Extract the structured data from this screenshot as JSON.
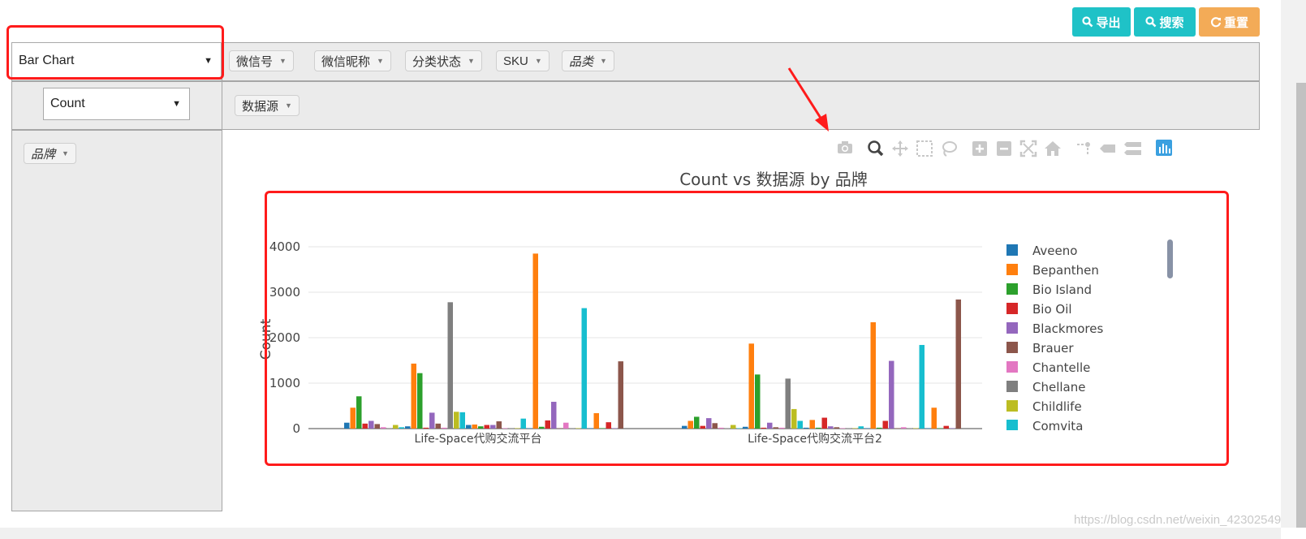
{
  "toolbar": {
    "export_label": "导出",
    "search_label": "搜索",
    "reset_label": "重置"
  },
  "pivot": {
    "renderer_selected": "Bar Chart",
    "aggregator_selected": "Count",
    "column_fields": [
      "微信号",
      "微信昵称",
      "分类状态",
      "SKU",
      "品类"
    ],
    "row_fields": [
      "数据源"
    ],
    "unused_fields": [
      "品牌"
    ]
  },
  "plot_toolbar": {
    "icons": [
      "camera-icon",
      "zoom-icon",
      "pan-icon",
      "box-select-icon",
      "lasso-icon",
      "zoom-in-icon",
      "zoom-out-icon",
      "autoscale-icon",
      "reset-axes-icon",
      "spike-lines-icon",
      "hover-closest-icon",
      "hover-compare-icon",
      "plotly-logo-icon"
    ]
  },
  "chart_data": {
    "type": "bar",
    "title": "Count vs 数据源 by 品牌",
    "xlabel": "",
    "ylabel": "Count",
    "ylim": [
      0,
      4500
    ],
    "yticks": [
      0,
      1000,
      2000,
      3000,
      4000
    ],
    "categories": [
      "Life-Space代购交流平台",
      "Life-Space代购交流平台2"
    ],
    "legend_position": "right",
    "legend_visible": [
      "Aveeno",
      "Bepanthen",
      "Bio Island",
      "Bio Oil",
      "Blackmores",
      "Brauer",
      "Chantelle",
      "Chellane",
      "Childlife",
      "Comvita"
    ],
    "series_values": [
      [
        130,
        60
      ],
      [
        460,
        170
      ],
      [
        710,
        260
      ],
      [
        110,
        60
      ],
      [
        170,
        230
      ],
      [
        100,
        120
      ],
      [
        30,
        20
      ],
      [
        10,
        10
      ],
      [
        80,
        80
      ],
      [
        30,
        10
      ],
      [
        50,
        40
      ],
      [
        1430,
        1870
      ],
      [
        1220,
        1190
      ],
      [
        20,
        20
      ],
      [
        350,
        130
      ],
      [
        110,
        30
      ],
      [
        20,
        20
      ],
      [
        2780,
        1100
      ],
      [
        370,
        430
      ],
      [
        360,
        170
      ],
      [
        80,
        20
      ],
      [
        90,
        190
      ],
      [
        50,
        20
      ],
      [
        80,
        240
      ],
      [
        80,
        50
      ],
      [
        160,
        30
      ],
      [
        10,
        10
      ],
      [
        10,
        10
      ],
      [
        10,
        10
      ],
      [
        220,
        50
      ],
      [
        10,
        10
      ],
      [
        3850,
        2340
      ],
      [
        40,
        20
      ],
      [
        180,
        170
      ],
      [
        590,
        1490
      ],
      [
        10,
        10
      ],
      [
        130,
        30
      ],
      [
        10,
        10
      ],
      [
        10,
        10
      ],
      [
        2650,
        1840
      ],
      [
        10,
        10
      ],
      [
        340,
        460
      ],
      [
        10,
        10
      ],
      [
        140,
        60
      ],
      [
        10,
        10
      ],
      [
        1480,
        2840
      ]
    ],
    "colors": [
      "#1f77b4",
      "#ff7f0e",
      "#2ca02c",
      "#d62728",
      "#9467bd",
      "#8c564b",
      "#e377c2",
      "#7f7f7f",
      "#bcbd22",
      "#17becf"
    ]
  }
}
